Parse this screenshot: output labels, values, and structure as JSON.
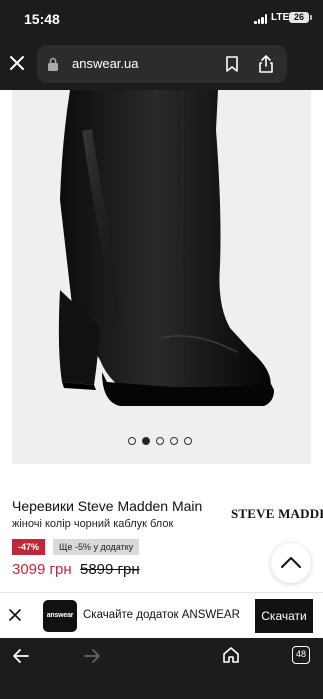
{
  "status_bar": {
    "time": "15:48",
    "network": "LTE",
    "battery": "26"
  },
  "browser": {
    "url": "answear.ua",
    "tabs_count": "48"
  },
  "product": {
    "image_dots_total": 5,
    "image_dots_active_index": 1,
    "title": "Черевики Steve Madden Main",
    "subtitle": "жіночі колір чорний каблук блок",
    "brand": "STEVE MADDEN",
    "discount_badge": "-47%",
    "app_badge": "Ще -5% у додатку",
    "price_current": "3099 грн",
    "price_old": "5899 грн"
  },
  "app_banner": {
    "icon_text": "answear",
    "text": "Скачайте додаток ANSWEAR",
    "button_label": "Скачати"
  },
  "colors": {
    "chrome_bg": "#1c1c1e",
    "sale_red": "#c0283a",
    "image_bg": "#efefef"
  }
}
